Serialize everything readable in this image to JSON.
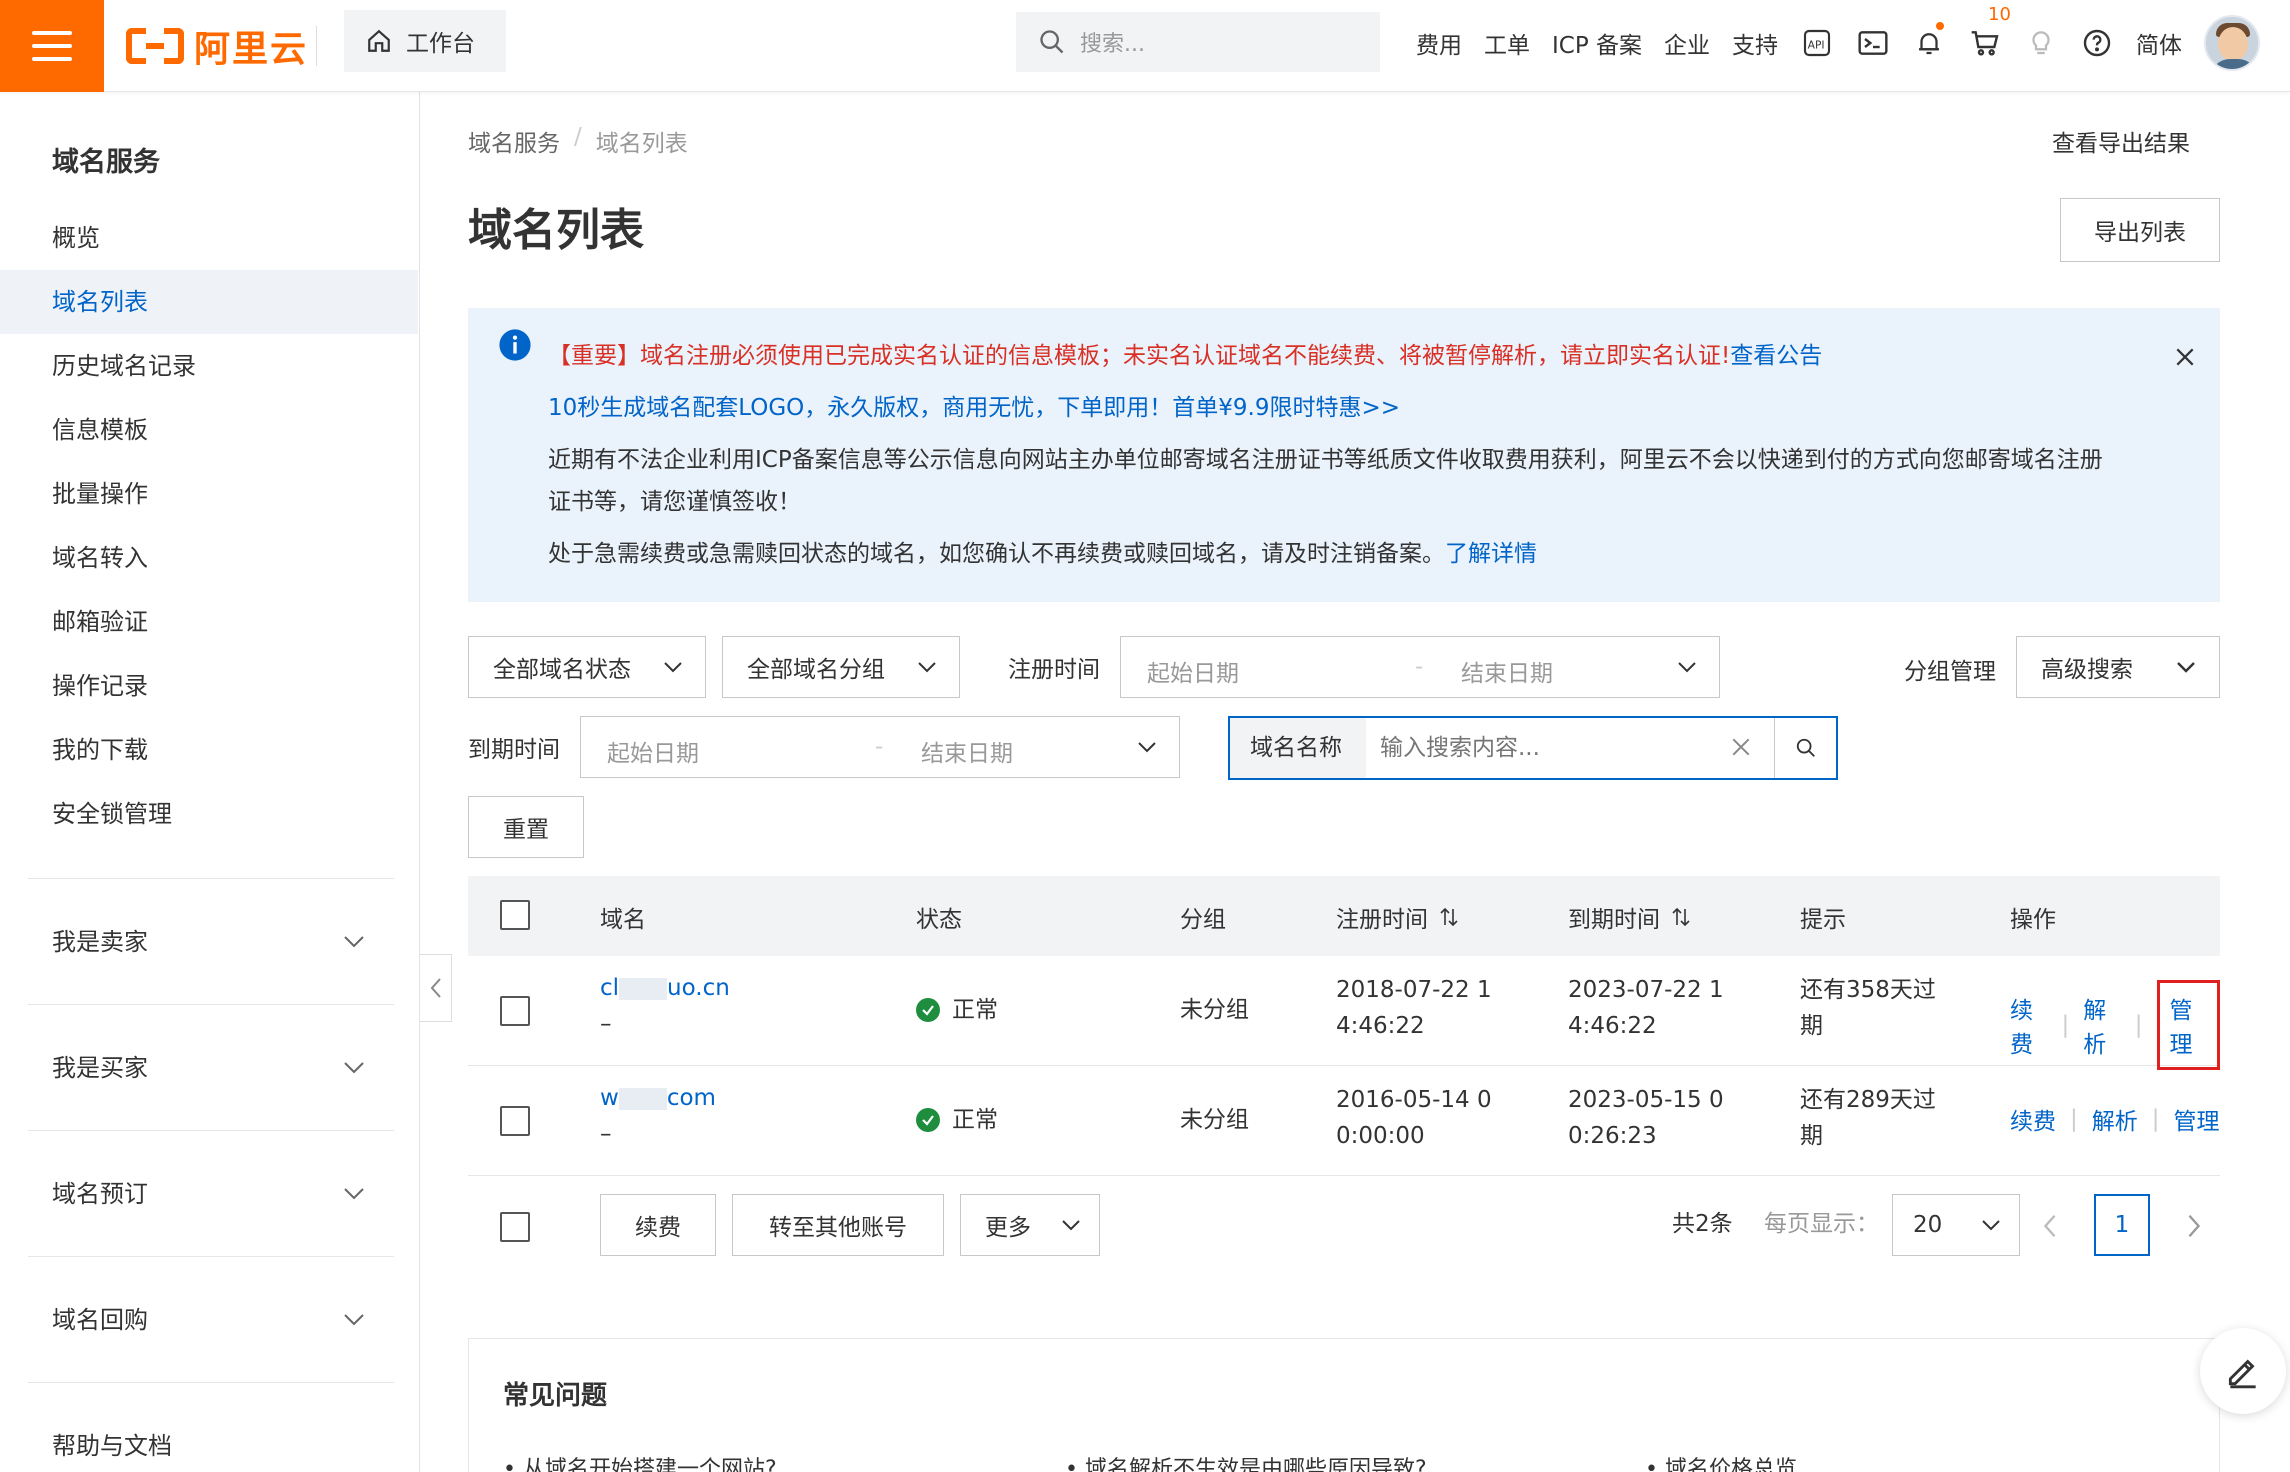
{
  "topbar": {
    "logo_text": "阿里云",
    "workbench_label": "工作台",
    "search_placeholder": "搜索...",
    "nav": [
      "费用",
      "工单",
      "ICP 备案",
      "企业",
      "支持"
    ],
    "cart_count": "10",
    "language": "简体",
    "accent_color": "#ff6a00"
  },
  "sidebar": {
    "title": "域名服务",
    "items": [
      "概览",
      "域名列表",
      "历史域名记录",
      "信息模板",
      "批量操作",
      "域名转入",
      "邮箱验证",
      "操作记录",
      "我的下载",
      "安全锁管理"
    ],
    "active_index": 1,
    "groups": [
      "我是卖家",
      "我是买家",
      "域名预订",
      "域名回购"
    ],
    "help": "帮助与文档"
  },
  "main": {
    "breadcrumb": [
      "域名服务",
      "域名列表"
    ],
    "breadcrumb_sep": "/",
    "export_result": "查看导出结果",
    "title": "域名列表",
    "export_button": "导出列表"
  },
  "notice": {
    "line1_red": "【重要】域名注册必须使用已完成实名认证的信息模板；未实名认证域名不能续费、将被暂停解析，请立即实名认证!",
    "line1_link": "查看公告",
    "line2_link": "10秒生成域名配套LOGO，永久版权，商用无忧，下单即用！首单¥9.9限时特惠>>",
    "line3": "近期有不法企业利用ICP备案信息等公示信息向网站主办单位邮寄域名注册证书等纸质文件收取费用获利，阿里云不会以快递到付的方式向您邮寄域名注册",
    "line4": "证书等，请您谨慎签收！",
    "line5": "处于急需续费或急需赎回状态的域名，如您确认不再续费或赎回域名，请及时注销备案。",
    "line5_link": "了解详情"
  },
  "filters": {
    "status_select": "全部域名状态",
    "group_select": "全部域名分组",
    "reg_time_label": "注册时间",
    "start_placeholder": "起始日期",
    "range_sep": "-",
    "end_placeholder": "结束日期",
    "group_manage": "分组管理",
    "advanced_search": "高级搜索",
    "expire_time_label": "到期时间",
    "search_key": "域名名称",
    "search_placeholder": "输入搜索内容...",
    "reset": "重置"
  },
  "table": {
    "headers": [
      "域名",
      "状态",
      "分组",
      "注册时间",
      "到期时间",
      "提示",
      "操作"
    ],
    "rows": [
      {
        "domain_a": "cl",
        "domain_b": "uo.cn",
        "sub": "–",
        "status": "正常",
        "group": "未分组",
        "reg1": "2018-07-22 1",
        "reg2": "4:46:22",
        "exp1": "2023-07-22 1",
        "exp2": "4:46:22",
        "tip1": "还有358天过",
        "tip2": "期",
        "ops": [
          "续费",
          "解析",
          "管理"
        ]
      },
      {
        "domain_a": "w",
        "domain_b": "com",
        "sub": "–",
        "status": "正常",
        "group": "未分组",
        "reg1": "2016-05-14 0",
        "reg2": "0:00:00",
        "exp1": "2023-05-15 0",
        "exp2": "0:26:23",
        "tip1": "还有289天过",
        "tip2": "期",
        "ops": [
          "续费",
          "解析",
          "管理"
        ]
      }
    ]
  },
  "footer": {
    "renew": "续费",
    "transfer": "转至其他账号",
    "more": "更多",
    "total": "共2条",
    "per_page_label": "每页显示：",
    "per_page": "20",
    "current_page": "1"
  },
  "faq": {
    "title": "常见问题",
    "items": [
      "从域名开始搭建一个网站?",
      "域名解析不生效是由哪些原因导致?",
      "域名价格总览"
    ]
  }
}
